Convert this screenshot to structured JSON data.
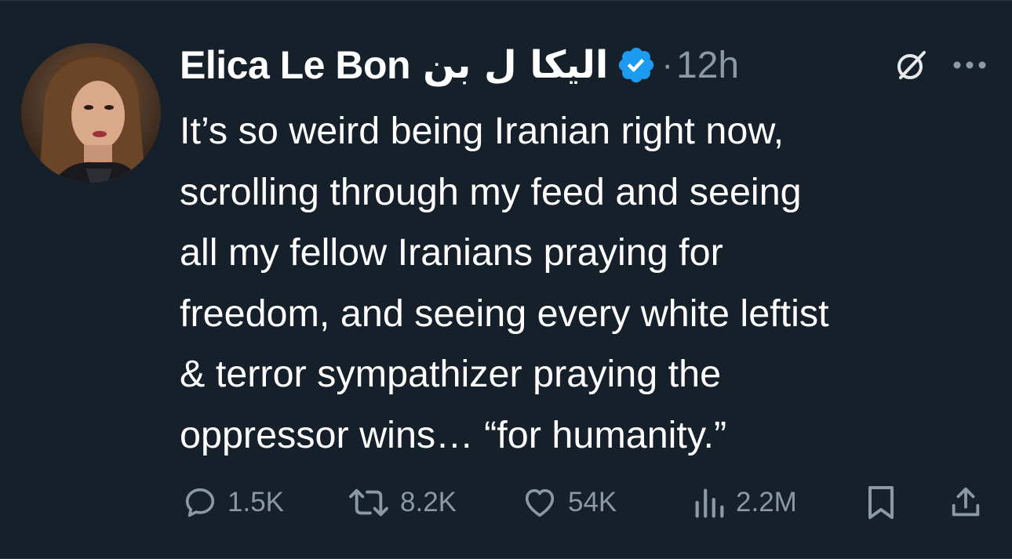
{
  "tweet": {
    "author": {
      "display_name": "Elica Le Bon",
      "display_name_arabic": "الیکا ل بن",
      "verified": true,
      "avatar_icon": "profile-photo"
    },
    "separator": "·",
    "timestamp": "12h",
    "text_lines": [
      "It’s so weird being Iranian right now,",
      "scrolling through my feed and seeing",
      "all my fellow Iranians praying for",
      "freedom, and seeing every white leftist",
      "& terror sympathizer praying the",
      "oppressor wins… “for humanity.”"
    ],
    "actions": {
      "replies": "1.5K",
      "reposts": "8.2K",
      "likes": "54K",
      "views": "2.2M"
    }
  },
  "colors": {
    "background": "#15202b",
    "text_primary": "#ffffff",
    "text_secondary": "#8b98a5",
    "verified_blue": "#1d9bf0"
  },
  "icons": [
    "grok-icon",
    "more-icon",
    "reply-icon",
    "repost-icon",
    "like-icon",
    "views-icon",
    "bookmark-icon",
    "share-icon"
  ]
}
